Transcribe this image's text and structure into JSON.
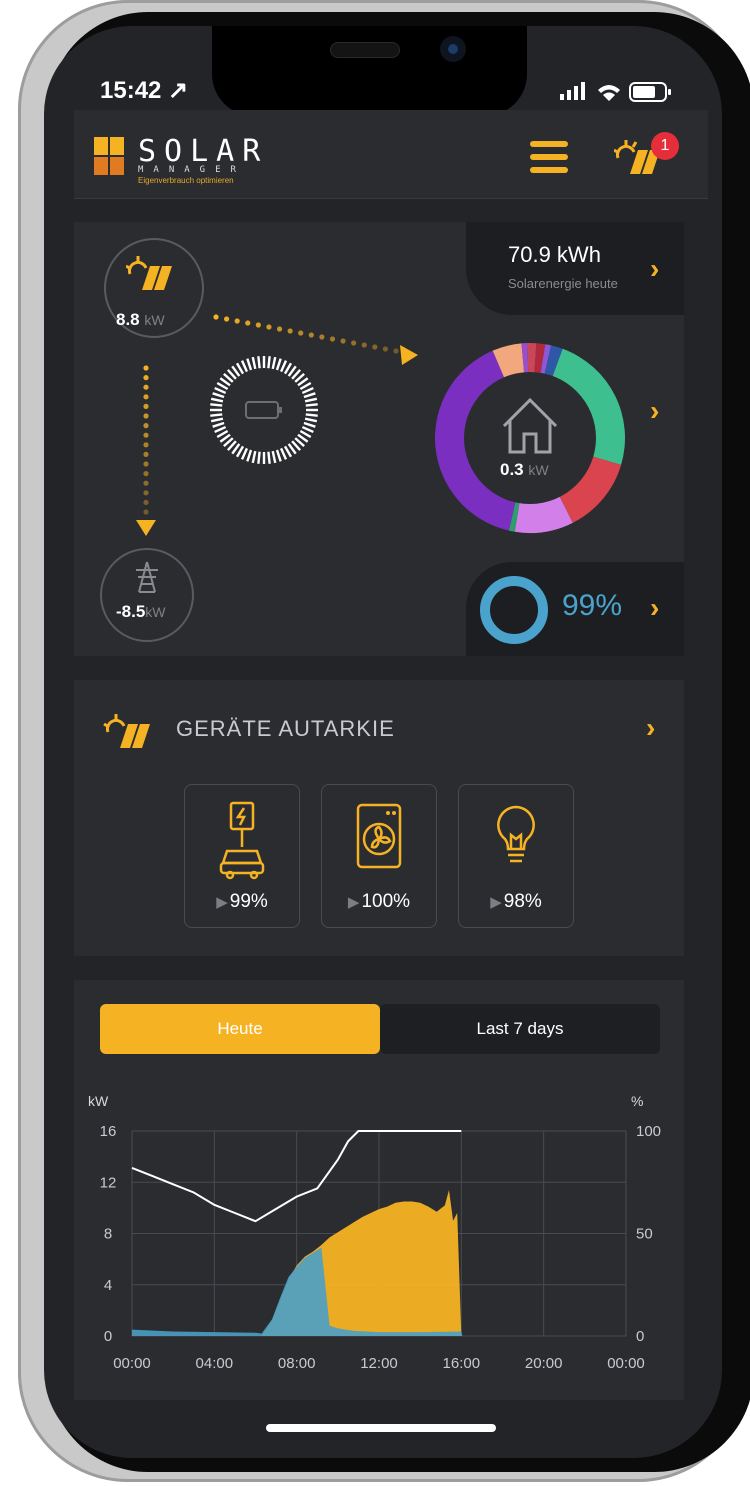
{
  "status": {
    "time": "15:42 ↗"
  },
  "brand": {
    "name": "SOLAR",
    "sub": "MANAGER",
    "tagline": "Eigenverbrauch optimieren"
  },
  "header": {
    "notification_count": "1"
  },
  "flow": {
    "solar_today": "70.9 kWh",
    "solar_today_label": "Solarenergie heute",
    "pv_power": "8.8",
    "house_power": "0.3",
    "grid_power": "-8.5",
    "unit": "kW",
    "autarky": "99%"
  },
  "consumption_donut": [
    {
      "color": "#3dbf8f",
      "value": 0.24
    },
    {
      "color": "#d9444f",
      "value": 0.13
    },
    {
      "color": "#d37fea",
      "value": 0.1
    },
    {
      "color": "#2f9e6e",
      "value": 0.01
    },
    {
      "color": "#7a2fc0",
      "value": 0.4
    },
    {
      "color": "#f2a77e",
      "value": 0.05
    },
    {
      "color": "#9b4ec9",
      "value": 0.01
    },
    {
      "color": "#c9475a",
      "value": 0.015
    },
    {
      "color": "#b02a3c",
      "value": 0.015
    },
    {
      "color": "#8f57d6",
      "value": 0.01
    },
    {
      "color": "#2e57a8",
      "value": 0.02
    }
  ],
  "geraete": {
    "title": "GERÄTE AUTARKIE",
    "devices": [
      {
        "icon": "ev-charger-icon",
        "value": "99%"
      },
      {
        "icon": "washing-machine-icon",
        "value": "100%"
      },
      {
        "icon": "lightbulb-icon",
        "value": "98%"
      }
    ]
  },
  "tabs": {
    "today": "Heute",
    "week": "Last 7 days"
  },
  "chart_data": {
    "type": "area",
    "xlabel": "",
    "ylabel": "kW",
    "y2label": "%",
    "x_ticks": [
      "00:00",
      "04:00",
      "08:00",
      "12:00",
      "16:00",
      "20:00",
      "00:00"
    ],
    "y_ticks": [
      "16",
      "12",
      "8",
      "4",
      "0"
    ],
    "y2_ticks": [
      "100",
      "50",
      "0"
    ],
    "ylim": [
      0,
      16
    ],
    "y2lim": [
      0,
      100
    ],
    "series": [
      {
        "color": "#f5b324",
        "x": [
          6.3,
          6.8,
          7.2,
          7.6,
          8.0,
          8.4,
          8.8,
          9.2,
          9.6,
          10.0,
          10.4,
          10.8,
          11.2,
          11.6,
          12.0,
          12.4,
          12.8,
          13.2,
          13.6,
          14.0,
          14.4,
          14.8,
          15.2,
          15.4,
          15.6,
          15.8,
          16.0
        ],
        "values": [
          0,
          1.2,
          2.8,
          4.4,
          5.5,
          6.2,
          6.6,
          7.1,
          7.7,
          8.1,
          8.5,
          8.9,
          9.3,
          9.6,
          9.9,
          10.1,
          10.4,
          10.5,
          10.5,
          10.4,
          10.1,
          9.7,
          10.2,
          11.4,
          9.0,
          9.6,
          0
        ]
      },
      {
        "color": "#4a9ec7",
        "x": [
          0,
          2,
          4,
          6,
          6.3,
          6.8,
          7.2,
          7.6,
          8.0,
          8.4,
          8.8,
          9.2,
          9.6,
          10.0,
          10.4,
          10.8,
          11.4,
          12.0,
          14.0,
          16.0,
          16.05
        ],
        "values": [
          0.5,
          0.35,
          0.3,
          0.25,
          0.2,
          1.3,
          3.0,
          4.6,
          5.4,
          6.1,
          6.5,
          6.9,
          0.8,
          0.6,
          0.5,
          0.4,
          0.35,
          0.3,
          0.3,
          0.35,
          0
        ]
      }
    ],
    "autarky_line": {
      "color": "#ffffff",
      "x": [
        0,
        1,
        2,
        3,
        4,
        5,
        6,
        7,
        8,
        9,
        10,
        10.5,
        11,
        12,
        16
      ],
      "values": [
        82,
        78,
        74,
        70,
        64,
        60,
        56,
        62,
        68,
        72,
        86,
        95,
        100,
        100,
        100
      ]
    }
  }
}
